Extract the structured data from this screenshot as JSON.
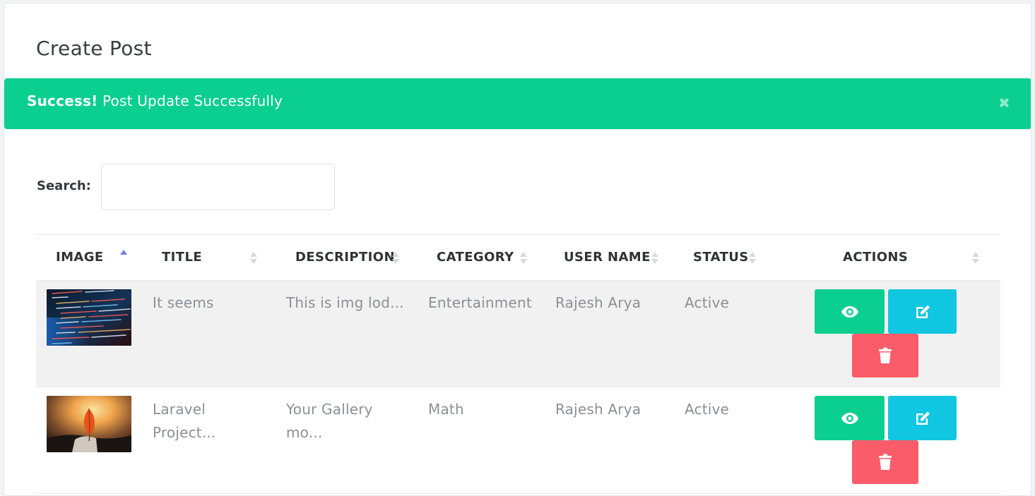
{
  "page": {
    "title": "Create Post"
  },
  "alert": {
    "strong": "Success!",
    "message": " Post Update Successfully",
    "close_glyph": "✖",
    "color": "#0acf8e"
  },
  "search": {
    "label": "Search:",
    "value": "",
    "placeholder": ""
  },
  "table": {
    "columns": [
      "IMAGE",
      "TITLE",
      "DESCRIPTION",
      "CATEGORY",
      "USER NAME",
      "STATUS",
      "ACTIONS"
    ],
    "sorted_column": "IMAGE",
    "rows": [
      {
        "image": "code-screen-image",
        "title": "It seems",
        "description": "This is img lod...",
        "category": "Entertainment",
        "user_name": "Rajesh Arya",
        "status": "Active"
      },
      {
        "image": "leaf-in-hand-image",
        "title": "Laravel Project...",
        "description": "Your Gallery mo...",
        "category": "Math",
        "user_name": "Rajesh Arya",
        "status": "Active"
      }
    ],
    "actions": {
      "view_icon": "eye-icon",
      "edit_icon": "edit-icon",
      "delete_icon": "trash-icon"
    }
  },
  "colors": {
    "view": "#0acf8e",
    "edit": "#10c6e0",
    "delete": "#fa5c6a",
    "sort_active": "#727cf5"
  }
}
